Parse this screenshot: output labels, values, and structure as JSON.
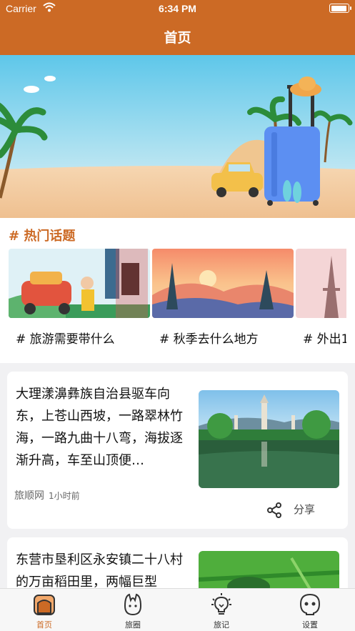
{
  "status_bar": {
    "carrier": "Carrier",
    "time": "6:34 PM",
    "battery_level": 0.95
  },
  "nav": {
    "title": "首页"
  },
  "banner": {
    "icon": "beach-suitcase-illustration"
  },
  "hot_topics": {
    "title": "# 热门话题",
    "items": [
      {
        "label": "# 旅游需要带什么"
      },
      {
        "label": "# 秋季去什么地方"
      },
      {
        "label": "# 外出1"
      }
    ]
  },
  "news": [
    {
      "text": "大理漾濞彝族自治县驱车向东，上苍山西坡，一路翠林竹海，一路九曲十八弯，海拔逐渐升高，车至山顶便…",
      "source": "旅顺网",
      "time": "1小时前",
      "share_label": "分享"
    },
    {
      "text": "东营市垦利区永安镇二十八村的万亩稻田里，两幅巨型"
    }
  ],
  "tabs": [
    {
      "label": "首页",
      "icon": "home-icon",
      "active": true
    },
    {
      "label": "旅圈",
      "icon": "circle-icon",
      "active": false
    },
    {
      "label": "旅记",
      "icon": "bulb-icon",
      "active": false
    },
    {
      "label": "设置",
      "icon": "settings-face-icon",
      "active": false
    }
  ],
  "colors": {
    "accent": "#cc6a25",
    "background": "#f1f1f3"
  }
}
